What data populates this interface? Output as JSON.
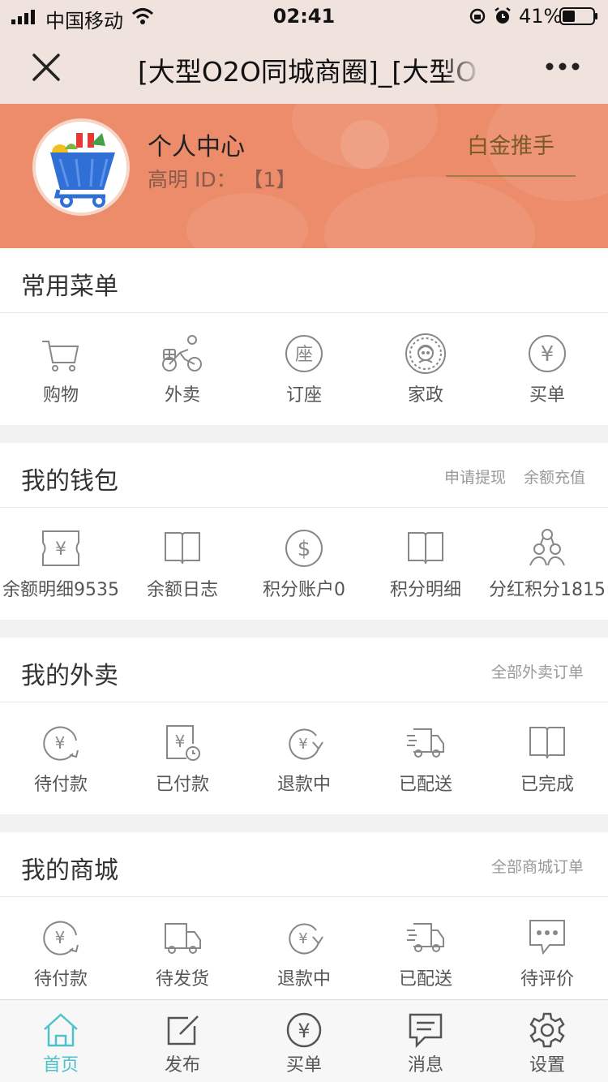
{
  "status_bar": {
    "carrier": "中国移动",
    "time": "02:41",
    "battery": "41%"
  },
  "nav": {
    "title": "[大型O2O同城商圈]_[大型O"
  },
  "profile": {
    "name": "个人中心",
    "id_line": "高明 ID： 【1】",
    "rank": "白金推手"
  },
  "menu": {
    "title": "常用菜单",
    "items": [
      {
        "label": "购物",
        "icon": "cart-icon"
      },
      {
        "label": "外卖",
        "icon": "bike-icon"
      },
      {
        "label": "订座",
        "icon": "seat-icon"
      },
      {
        "label": "家政",
        "icon": "housekeeping-icon"
      },
      {
        "label": "买单",
        "icon": "yen-circle-icon"
      }
    ]
  },
  "wallet": {
    "title": "我的钱包",
    "link1": "申请提现",
    "link2": "余额充值",
    "items": [
      {
        "label": "余额明细9535",
        "icon": "yen-ticket-icon"
      },
      {
        "label": "余额日志",
        "icon": "book-icon"
      },
      {
        "label": "积分账户0",
        "icon": "dollar-circle-icon"
      },
      {
        "label": "积分明细",
        "icon": "book-icon"
      },
      {
        "label": "分红积分1815",
        "icon": "network-icon"
      }
    ]
  },
  "takeout": {
    "title": "我的外卖",
    "link": "全部外卖订单",
    "items": [
      {
        "label": "待付款",
        "icon": "yen-refresh-icon"
      },
      {
        "label": "已付款",
        "icon": "paid-receipt-icon"
      },
      {
        "label": "退款中",
        "icon": "refund-icon"
      },
      {
        "label": "已配送",
        "icon": "delivery-truck-icon"
      },
      {
        "label": "已完成",
        "icon": "book-icon"
      }
    ]
  },
  "mall": {
    "title": "我的商城",
    "link": "全部商城订单",
    "items": [
      {
        "label": "待付款",
        "icon": "yen-refresh-icon"
      },
      {
        "label": "待发货",
        "icon": "truck-icon"
      },
      {
        "label": "退款中",
        "icon": "refund-icon"
      },
      {
        "label": "已配送",
        "icon": "delivery-truck-icon"
      },
      {
        "label": "待评价",
        "icon": "comment-icon"
      }
    ]
  },
  "tabbar": {
    "items": [
      {
        "label": "首页",
        "icon": "home-icon"
      },
      {
        "label": "发布",
        "icon": "edit-icon"
      },
      {
        "label": "买单",
        "icon": "yen-circle-icon"
      },
      {
        "label": "消息",
        "icon": "message-icon"
      },
      {
        "label": "设置",
        "icon": "settings-icon"
      }
    ],
    "active_color": "#4fc2c9"
  },
  "colors": {
    "banner": "#ec8c6b",
    "topbar": "#f0e3de",
    "rank": "#7b5a28"
  }
}
